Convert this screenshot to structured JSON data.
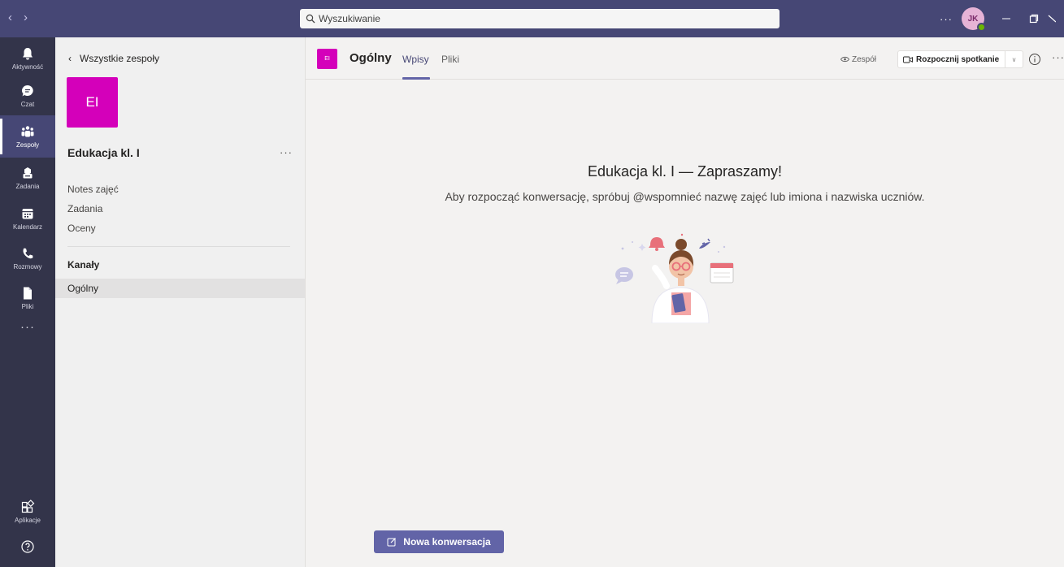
{
  "search": {
    "placeholder": "Wyszukiwanie"
  },
  "user": {
    "initials": "JK"
  },
  "rail": {
    "items": [
      {
        "label": "Aktywność",
        "icon": "bell-icon"
      },
      {
        "label": "Czat",
        "icon": "chat-icon"
      },
      {
        "label": "Zespoły",
        "icon": "teams-icon",
        "active": true
      },
      {
        "label": "Zadania",
        "icon": "assignments-icon"
      },
      {
        "label": "Kalendarz",
        "icon": "calendar-icon"
      },
      {
        "label": "Rozmowy",
        "icon": "phone-icon"
      },
      {
        "label": "Pliki",
        "icon": "file-icon"
      }
    ],
    "apps_label": "Aplikacje"
  },
  "panel": {
    "back_label": "Wszystkie zespoły",
    "team_initials": "EI",
    "team_name": "Edukacja kl. I",
    "links": [
      "Notes zajęć",
      "Zadania",
      "Oceny"
    ],
    "channels_heading": "Kanały",
    "channels": [
      "Ogólny"
    ]
  },
  "channel": {
    "initials": "EI",
    "name": "Ogólny",
    "tabs": [
      "Wpisy",
      "Pliki"
    ],
    "team_chip_label": "Zespół",
    "meet_label": "Rozpocznij spotkanie"
  },
  "welcome": {
    "title": "Edukacja kl. I — Zapraszamy!",
    "subtitle": "Aby rozpocząć konwersację, spróbuj @wspomnieć nazwę zajęć lub imiona i nazwiska uczniów."
  },
  "compose": {
    "button_label": "Nowa konwersacja"
  },
  "colors": {
    "accent": "#6264a7",
    "titlebar": "#464775",
    "rail": "#33344a",
    "team_tile": "#d400ba"
  }
}
